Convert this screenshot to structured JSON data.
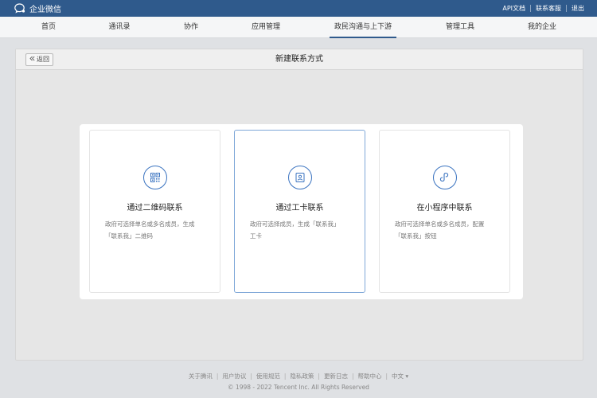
{
  "brand": {
    "name": "企业微信"
  },
  "toplinks": [
    {
      "label": "API文档"
    },
    {
      "label": "联系客服"
    },
    {
      "label": "退出"
    }
  ],
  "nav": {
    "items": [
      {
        "label": "首页"
      },
      {
        "label": "通讯录"
      },
      {
        "label": "协作"
      },
      {
        "label": "应用管理"
      },
      {
        "label": "政民沟通与上下游",
        "active": true
      },
      {
        "label": "管理工具"
      },
      {
        "label": "我的企业"
      }
    ]
  },
  "panel": {
    "back_label": "返回",
    "title": "新建联系方式"
  },
  "cards": [
    {
      "icon": "qrcode-icon",
      "title": "通过二维码联系",
      "desc_line1": "政府可选择单名或多名成员，生成",
      "desc_line2": "「联系我」二维码"
    },
    {
      "icon": "work-card-icon",
      "title": "通过工卡联系",
      "desc_line1": "政府可选择成员，生成「联系我」",
      "desc_line2": "工卡"
    },
    {
      "icon": "mini-program-icon",
      "title": "在小程序中联系",
      "desc_line1": "政府可选择单名或多名成员，配置",
      "desc_line2": "「联系我」按钮"
    }
  ],
  "footer": {
    "links": [
      {
        "label": "关于腾讯"
      },
      {
        "label": "用户协议"
      },
      {
        "label": "使用规范"
      },
      {
        "label": "隐私政策"
      },
      {
        "label": "更新日志"
      },
      {
        "label": "帮助中心"
      },
      {
        "label": "中文 ▾"
      }
    ],
    "copyright": "© 1998 - 2022 Tencent Inc. All Rights Reserved"
  },
  "colors": {
    "brand": "#2f5a8c",
    "accent": "#3a73c0"
  }
}
